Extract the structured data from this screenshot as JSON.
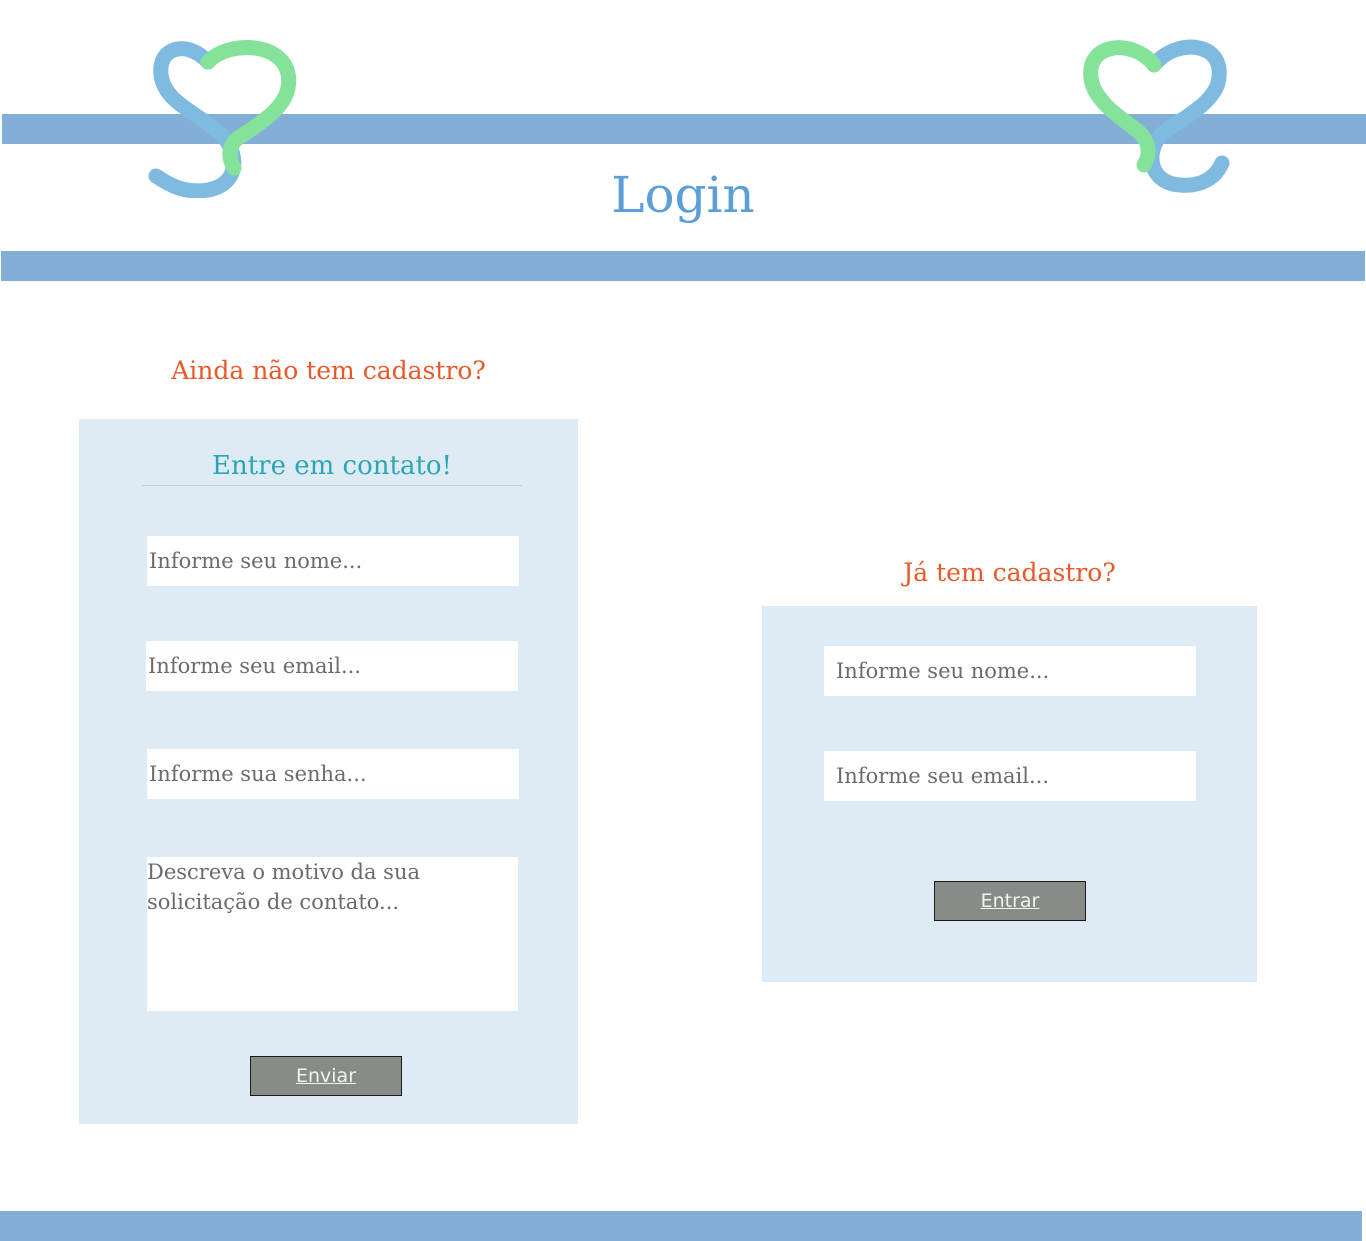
{
  "header": {
    "title": "Login",
    "logo_icon": "heart-ribbon-icon",
    "colors": {
      "band": "#83aed6",
      "logo_blue": "#7fbbe0",
      "logo_green": "#85e29a",
      "title": "#5b9fd6"
    }
  },
  "register": {
    "question": "Ainda não tem cadastro?",
    "heading": "Entre em contato!",
    "name_placeholder": "Informe seu nome...",
    "email_placeholder": "Informe seu email...",
    "password_placeholder": "Informe sua senha...",
    "reason_placeholder": "Descreva o motivo da sua solicitação de contato...",
    "submit_label": "Enviar"
  },
  "login": {
    "question": "Já tem cadastro?",
    "name_placeholder": "Informe seu nome...",
    "email_placeholder": "Informe seu email...",
    "submit_label": "Entrar"
  },
  "colors": {
    "accent_orange": "#e8592a",
    "accent_teal": "#2ba7b3",
    "panel": "#deebf5",
    "button": "#878c86"
  }
}
